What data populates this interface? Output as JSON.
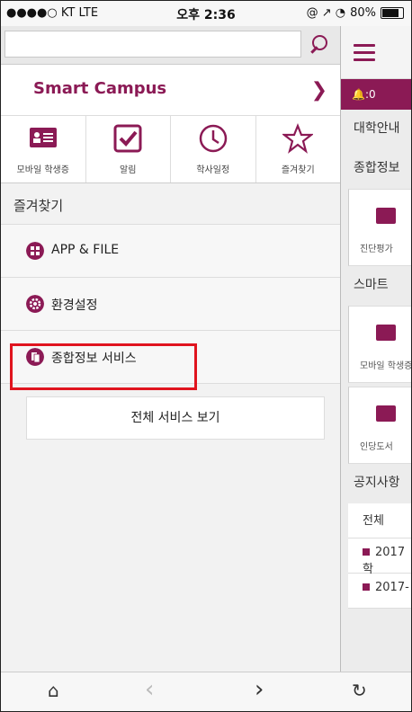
{
  "status": {
    "carrier": "●●●●○ KT  LTE",
    "time": "오후 2:36",
    "icons": "@ ↗ ◔",
    "battery": "80%",
    "battery_level": 0.8
  },
  "search": {
    "value": "",
    "placeholder": ""
  },
  "smart_campus": {
    "title": "Smart Campus",
    "chevron": "❯"
  },
  "quick": [
    {
      "label": "모바일 학생증",
      "icon": "student-id-icon"
    },
    {
      "label": "알림",
      "icon": "checkbox-icon"
    },
    {
      "label": "학사일정",
      "icon": "clock-icon"
    },
    {
      "label": "즐겨찾기",
      "icon": "star-icon"
    }
  ],
  "favorites_header": "즐겨찾기",
  "menu": [
    {
      "label": "APP & FILE",
      "icon": "grid-icon"
    },
    {
      "label": "환경설정",
      "icon": "gear-icon"
    },
    {
      "label": "종합정보 서비스",
      "icon": "document-icon"
    }
  ],
  "all_services": "전체 서비스 보기",
  "background_app": {
    "bell_count": "🔔:0",
    "sections": [
      "대학안내",
      "종합정보",
      "스마트",
      "공지사항"
    ],
    "cards": [
      "진단평가",
      "모바일 학생증",
      "인당도서"
    ],
    "rows": [
      "전체",
      "2017학",
      "2017-"
    ]
  },
  "toolbar": {
    "home": "⌂",
    "back": "‹",
    "forward": "›",
    "reload": "↻"
  },
  "colors": {
    "accent": "#8b1a55",
    "highlight": "#e0141e"
  }
}
